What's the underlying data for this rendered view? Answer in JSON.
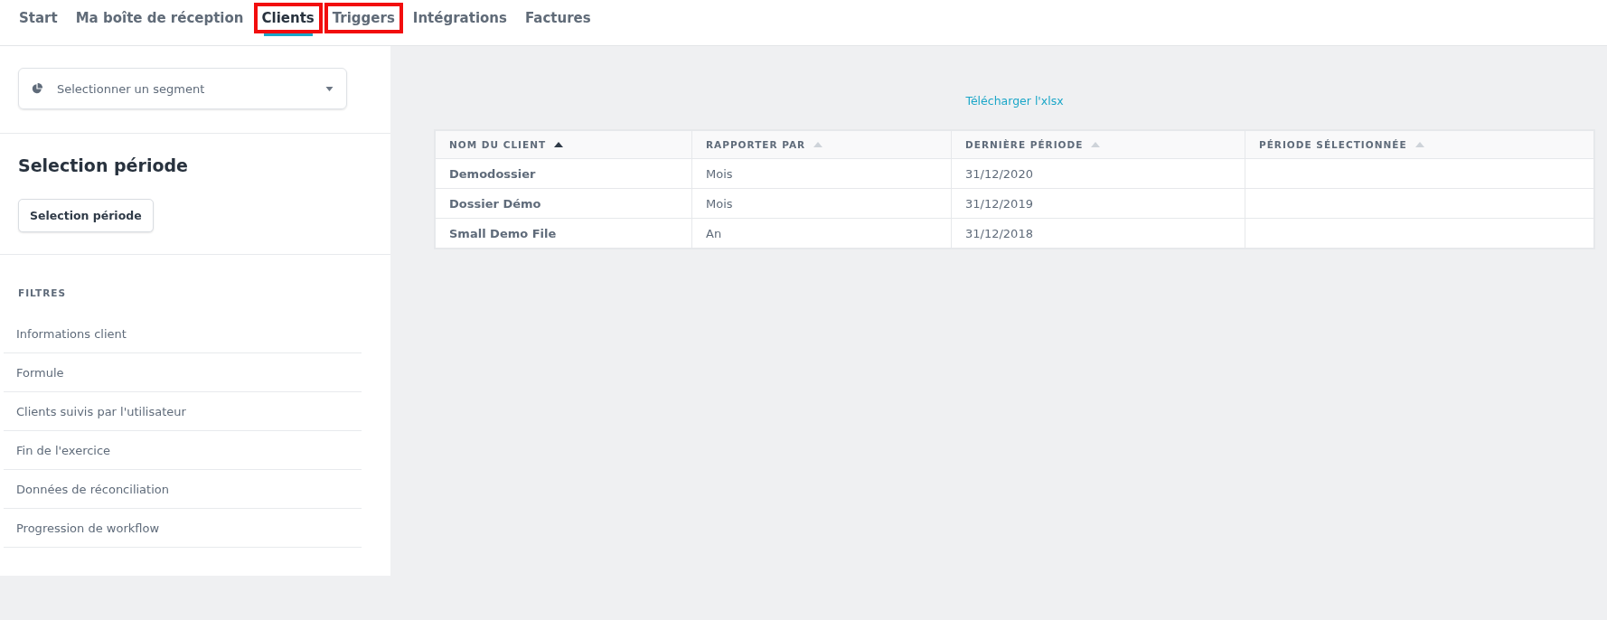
{
  "tabs": [
    {
      "label": "Start",
      "selected": false,
      "highlighted": false
    },
    {
      "label": "Ma boîte de réception",
      "selected": false,
      "highlighted": false
    },
    {
      "label": "Clients",
      "selected": true,
      "highlighted": true
    },
    {
      "label": "Triggers",
      "selected": false,
      "highlighted": true
    },
    {
      "label": "Intégrations",
      "selected": false,
      "highlighted": false
    },
    {
      "label": "Factures",
      "selected": false,
      "highlighted": false
    }
  ],
  "sidebar": {
    "segment_select": {
      "placeholder": "Selectionner un segment"
    },
    "period": {
      "title": "Selection période",
      "button": "Selection période"
    },
    "filters": {
      "title": "FILTRES",
      "items": [
        "Informations client",
        "Formule",
        "Clients suivis par l'utilisateur",
        "Fin de l'exercice",
        "Données de réconciliation",
        "Progression de workflow"
      ]
    }
  },
  "download_link": "Télécharger l'xlsx",
  "table": {
    "columns": [
      {
        "label": "NOM DU CLIENT",
        "sorted": true
      },
      {
        "label": "RAPPORTER PAR",
        "sorted": false
      },
      {
        "label": "DERNIÈRE PÉRIODE",
        "sorted": false
      },
      {
        "label": "PÉRIODE SÉLECTIONNÉE",
        "sorted": false
      }
    ],
    "rows": [
      [
        "Demodossier",
        "Mois",
        "31/12/2020",
        ""
      ],
      [
        "Dossier Démo",
        "Mois",
        "31/12/2019",
        ""
      ],
      [
        "Small Demo File",
        "An",
        "31/12/2018",
        ""
      ]
    ]
  }
}
